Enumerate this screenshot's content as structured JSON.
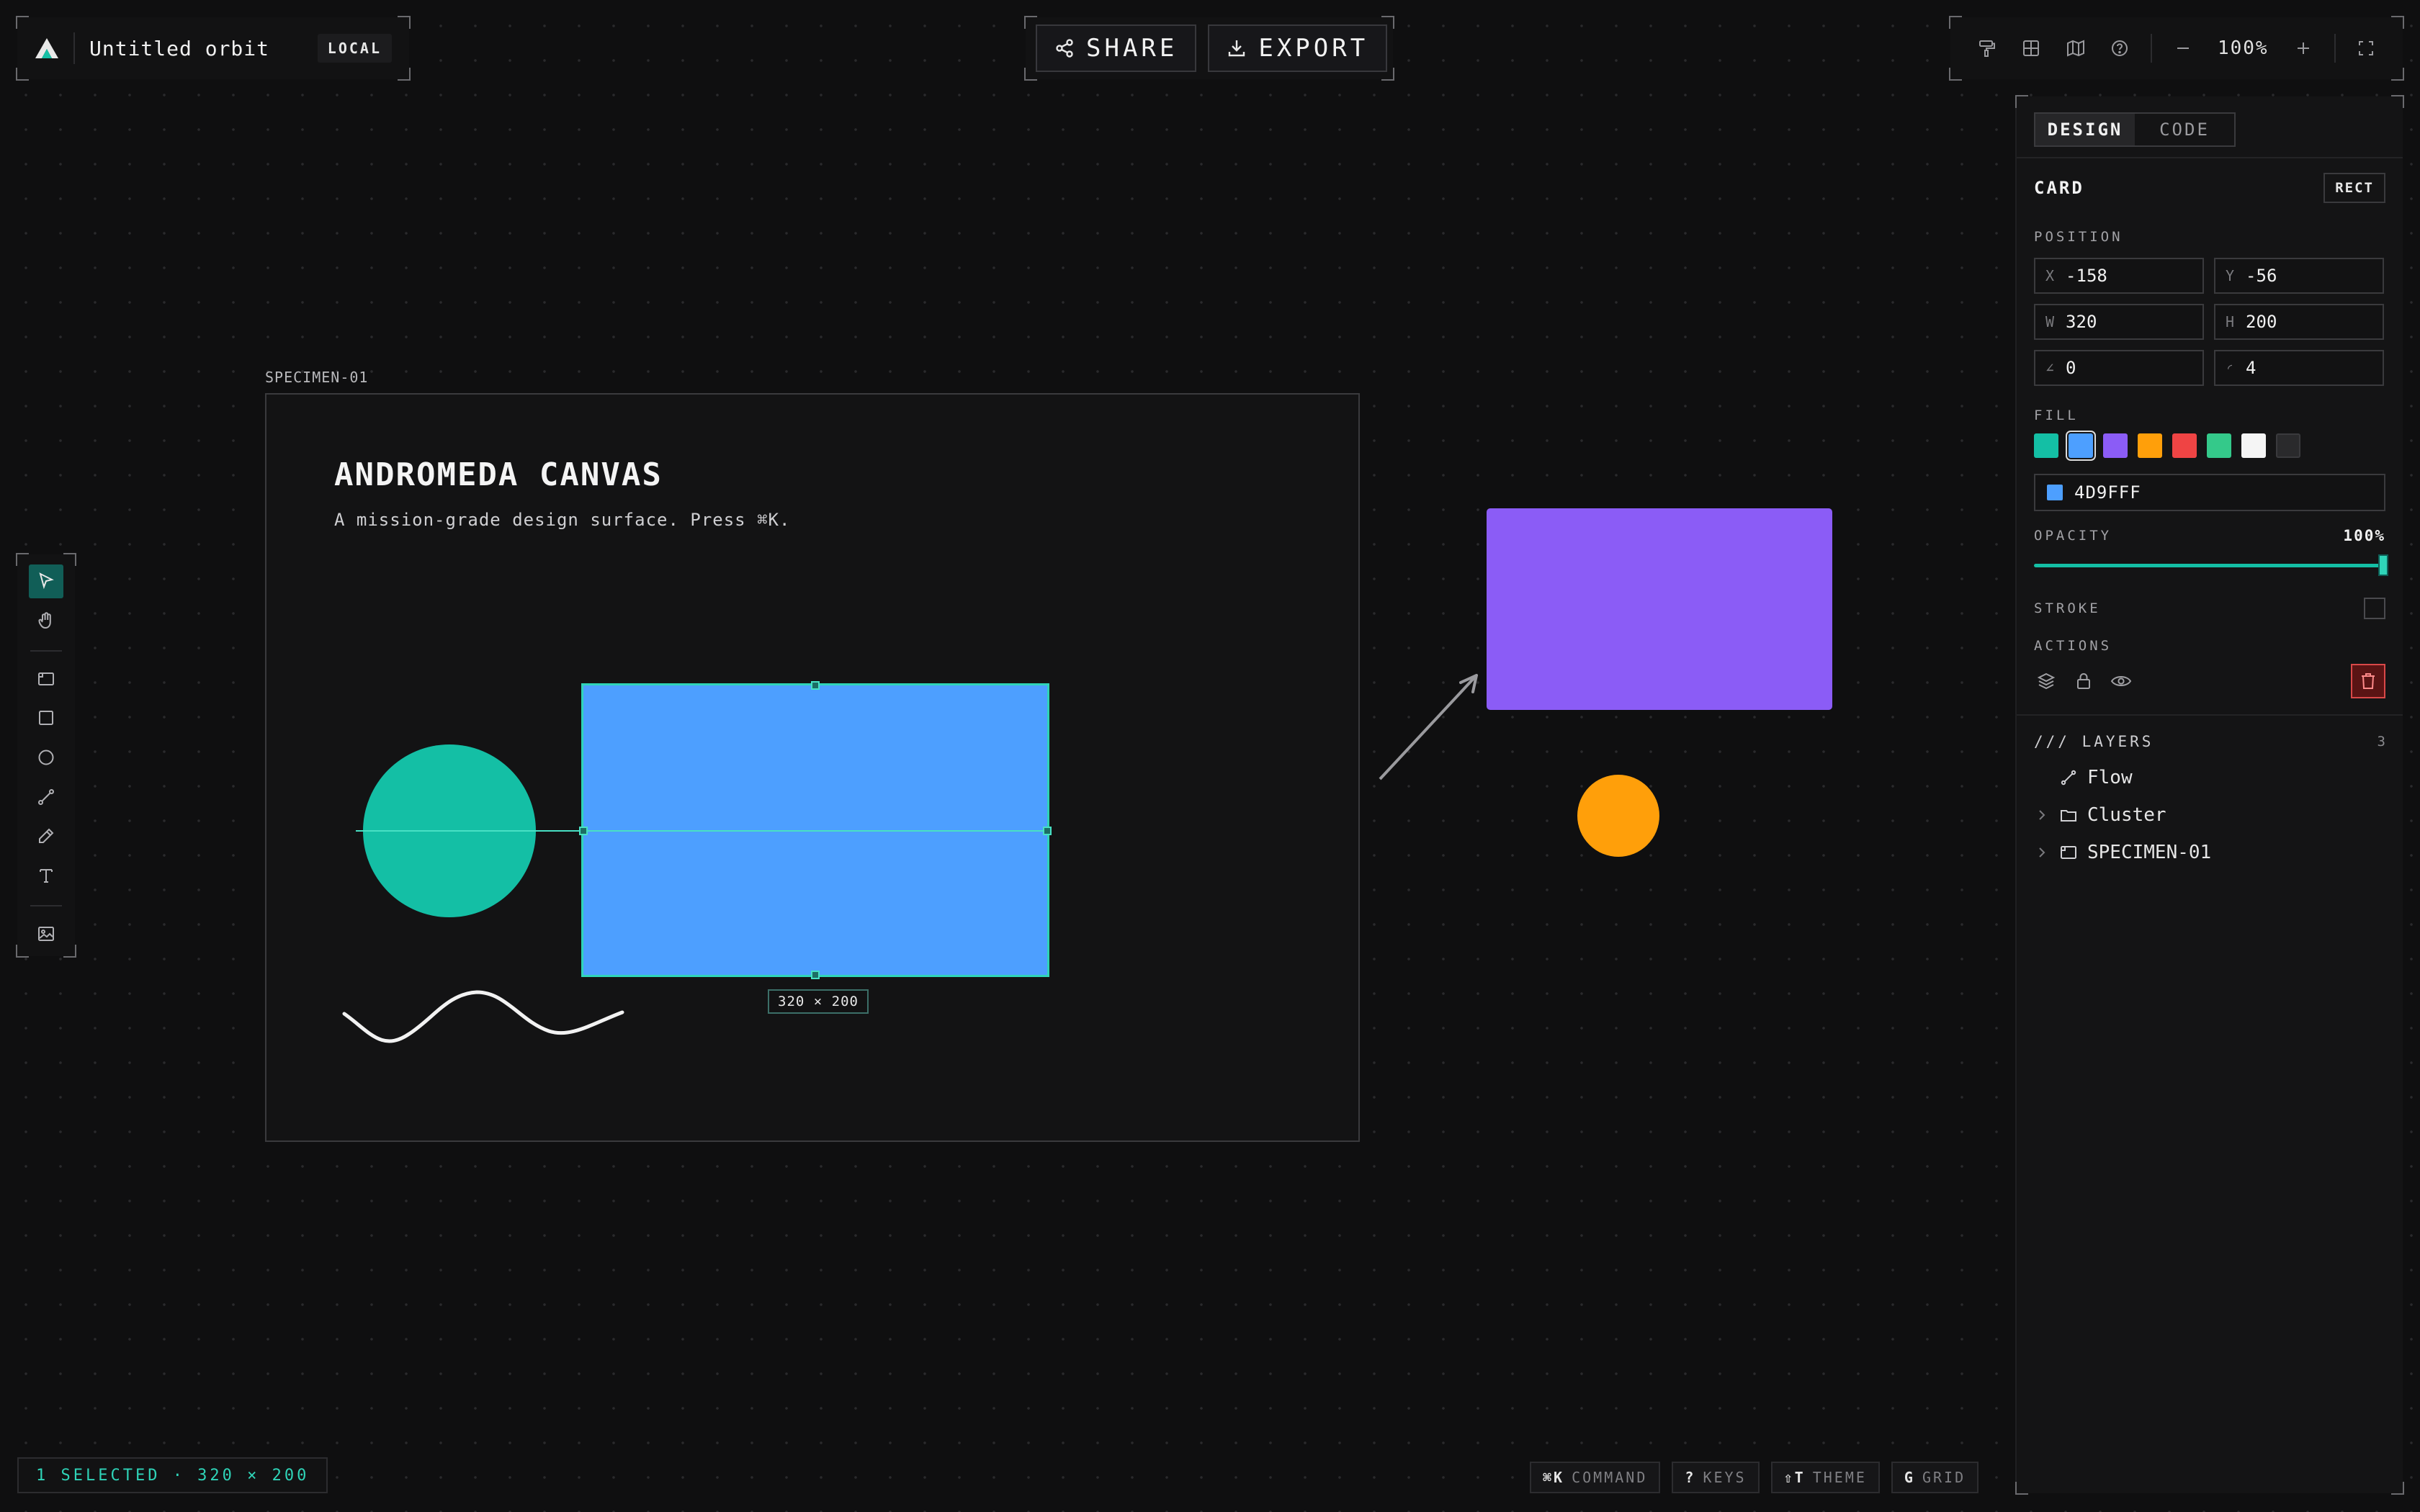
{
  "app": {
    "doc_title": "Untitled orbit",
    "storage_badge": "LOCAL",
    "accent": "#14bfa5"
  },
  "header": {
    "share_label": "SHARE",
    "export_label": "EXPORT",
    "zoom": "100%"
  },
  "canvas": {
    "frame_label": "SPECIMEN-01",
    "title": "ANDROMEDA CANVAS",
    "subtitle": "A mission-grade design surface. Press ⌘K.",
    "selection_size": "320 × 200",
    "shape_colors": {
      "circle": "#14bfa5",
      "card": "#4d9fff",
      "purple_rect": "#8b5cf6",
      "orange_circle": "#ff9f0a"
    }
  },
  "panel": {
    "tabs": [
      "DESIGN",
      "CODE"
    ],
    "active_tab": "DESIGN",
    "selection_name": "CARD",
    "selection_type": "RECT",
    "position_label": "POSITION",
    "fields": [
      {
        "label": "X",
        "value": "-158"
      },
      {
        "label": "Y",
        "value": "-56"
      },
      {
        "label": "W",
        "value": "320"
      },
      {
        "label": "H",
        "value": "200"
      },
      {
        "label": "∠",
        "value": "0"
      },
      {
        "label": "◜",
        "value": "4"
      }
    ],
    "fill_label": "FILL",
    "swatches": [
      "#14bfa5",
      "#4d9fff",
      "#8b5cf6",
      "#ff9f0a",
      "#ef4444",
      "#34c98a",
      "#f5f5f5",
      "#2a2a2c"
    ],
    "selected_swatch": "#4d9fff",
    "hex_value": "4D9FFF",
    "opacity_label": "OPACITY",
    "opacity_value": "100%",
    "opacity_fraction": 1.0,
    "stroke_label": "STROKE",
    "actions_label": "ACTIONS",
    "layers_label": "/// LAYERS",
    "layers_count": "3",
    "layers": [
      {
        "name": "Flow",
        "icon": "path-icon",
        "expandable": false
      },
      {
        "name": "Cluster",
        "icon": "folder-icon",
        "expandable": true
      },
      {
        "name": "SPECIMEN-01",
        "icon": "frame-icon",
        "expandable": true
      }
    ]
  },
  "status": {
    "selection": "1 SELECTED · 320 × 200"
  },
  "hints": [
    {
      "key": "⌘K",
      "label": "COMMAND"
    },
    {
      "key": "?",
      "label": "KEYS"
    },
    {
      "key": "⇧T",
      "label": "THEME"
    },
    {
      "key": "G",
      "label": "GRID"
    }
  ]
}
